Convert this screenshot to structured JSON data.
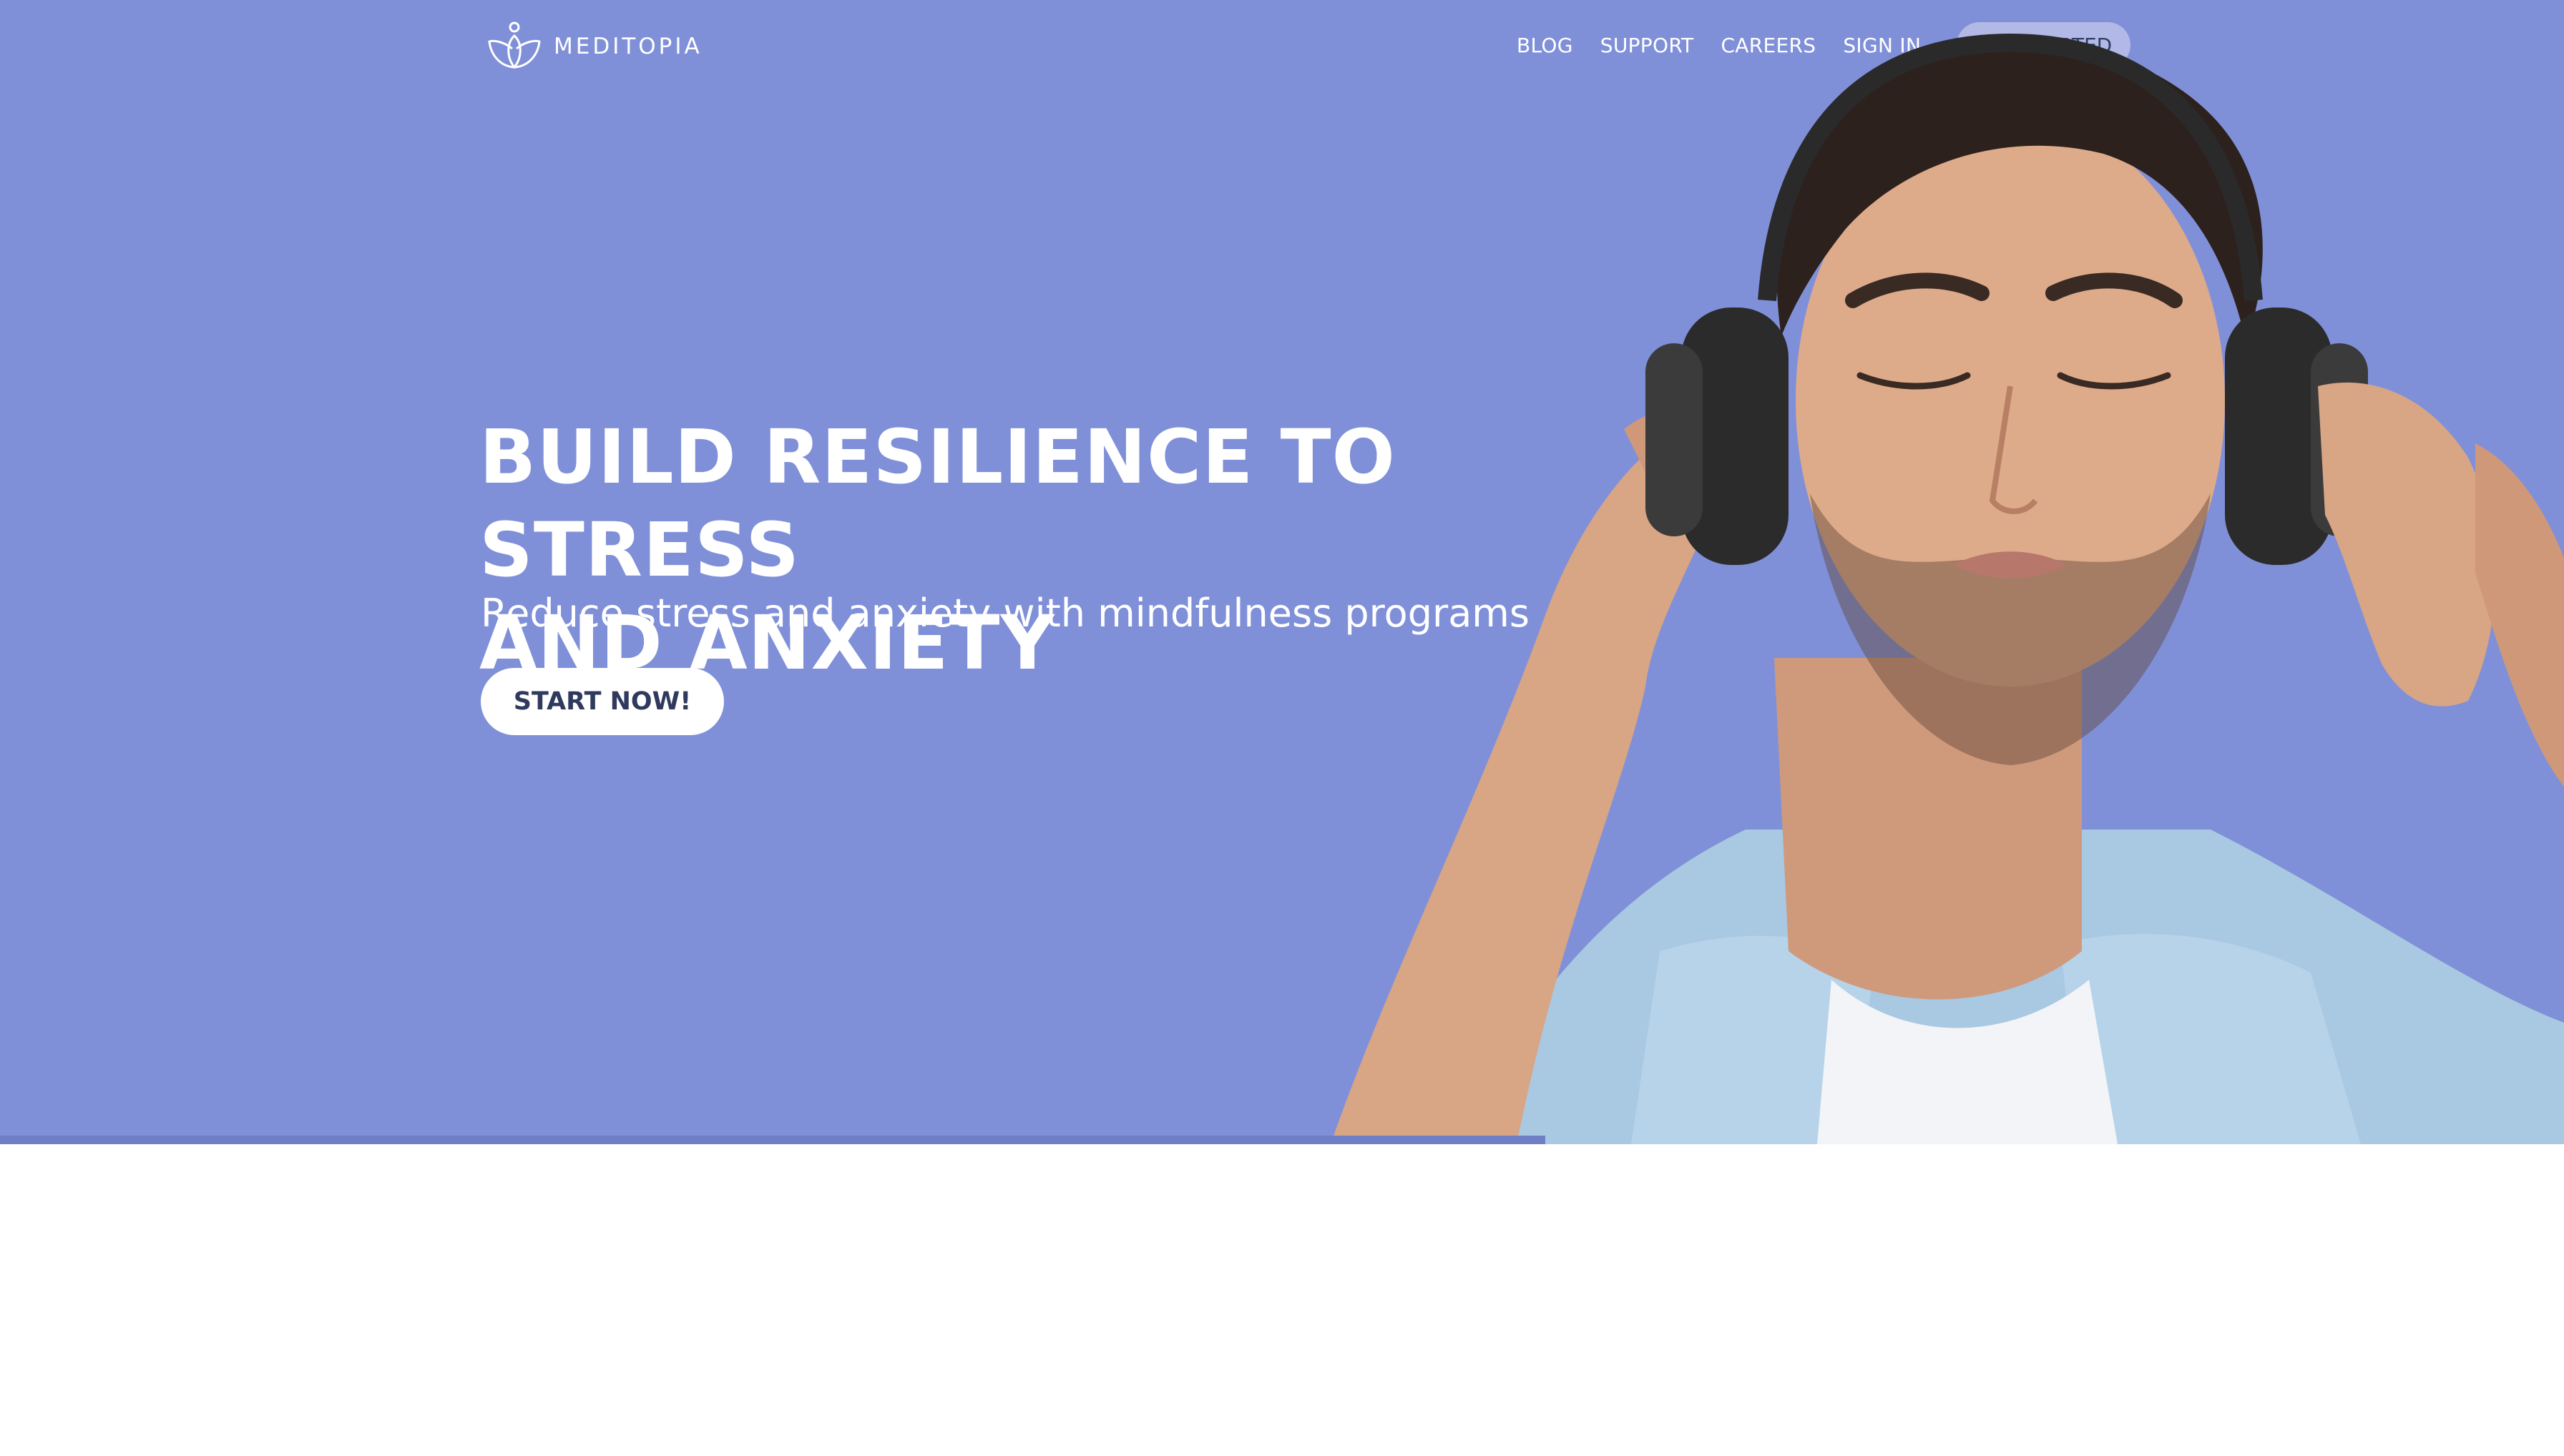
{
  "brand": {
    "name": "MEDITOPIA",
    "logo_icon": "lotus-icon"
  },
  "nav": {
    "links": [
      "BLOG",
      "SUPPORT",
      "CAREERS",
      "SIGN IN"
    ],
    "cta": "GET STARTED"
  },
  "hero": {
    "headline_line1": "BUILD RESILIENCE TO STRESS",
    "headline_line2": "AND ANXIETY",
    "subheadline": "Reduce stress and anxiety with mindfulness programs",
    "button": "START NOW!",
    "image_icon": "man-with-headphones-photo"
  },
  "colors": {
    "hero_background": "#8090d8",
    "cta_background": "#b2b9e6",
    "button_text": "#2f3a5e",
    "page_background": "#ffffff"
  }
}
